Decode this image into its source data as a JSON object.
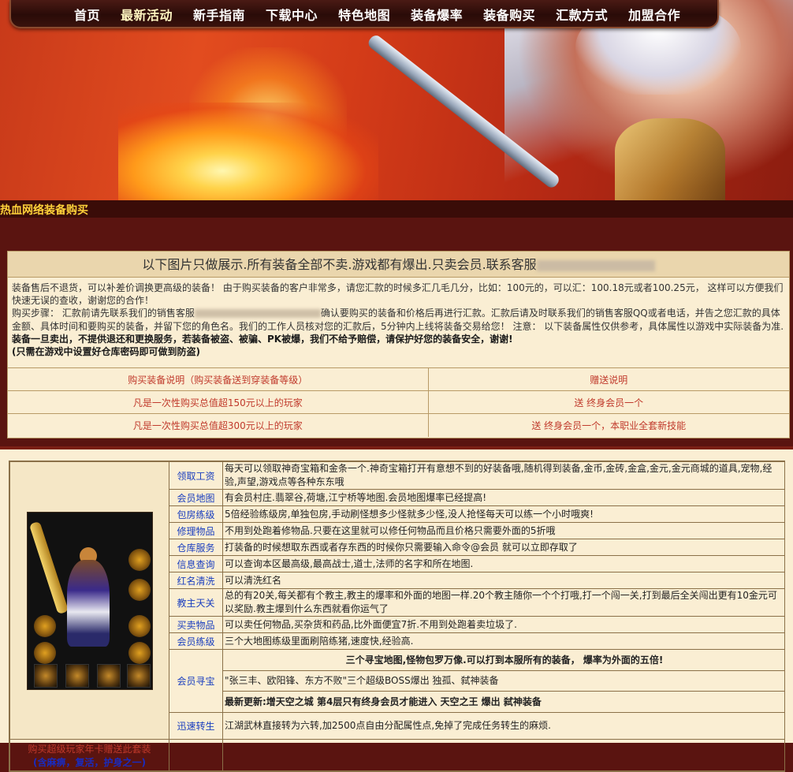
{
  "nav": {
    "items": [
      "首页",
      "最新活动",
      "新手指南",
      "下载中心",
      "特色地图",
      "装备爆率",
      "装备购买",
      "汇款方式",
      "加盟合作"
    ]
  },
  "strip": {
    "title": "热血网络装备购买"
  },
  "info": {
    "headline": "以下图片只做展示.所有装备全部不卖.游戏都有爆出.只卖会员.联系客服",
    "p1": "装备售后不退货，可以补差价调换更高级的装备！ 由于购买装备的客户非常多，请您汇款的时候多汇几毛几分，比如：100元的，可以汇：100.18元或者100.25元， 这样可以方便我们快速无误的查收，谢谢您的合作！",
    "p2a": "购买步骤： 汇款前请先联系我们的销售客服",
    "p2b": "确认要购买的装备和价格后再进行汇款。汇款后请及时联系我们的销售客服QQ或者电话，并告之您汇款的具体金额、具体时间和要购买的装备，并留下您的角色名。我们的工作人员核对您的汇款后，5分钟内上线将装备交易给您！ 注意： 以下装备属性仅供参考，具体属性以游戏中实际装备为准.",
    "p2c": "装备一旦卖出，不提供退还和更换服务，若装备被盗、被骗、PK被爆，我们不给予赔偿，请保护好您的装备安全，谢谢!",
    "p3": "(只需在游戏中设置好仓库密码即可做到防盗)",
    "table": [
      [
        "购买装备说明（购买装备送到穿装备等级）",
        "赠送说明"
      ],
      [
        "凡是一次性购买总值超150元以上的玩家",
        "送 终身会员一个"
      ],
      [
        "凡是一次性购买总值超300元以上的玩家",
        "送 终身会员一个，本职业全套新技能"
      ]
    ]
  },
  "features": [
    {
      "label": "领取工资",
      "desc": "每天可以领取神奇宝箱和金条一个.神奇宝箱打开有意想不到的好装备哦,随机得到装备,金币,金砖,金盒,金元,金元商城的道具,宠物,经验,声望,游戏点等各种东东哦"
    },
    {
      "label": "会员地图",
      "desc": "有会员村庄.翡翠谷,荷塘,江宁桥等地图.会员地图爆率已经提高!"
    },
    {
      "label": "包房练级",
      "desc": "5倍经验练级房,单独包房,手动刷怪想多少怪就多少怪,没人抢怪每天可以练一个小时哦爽!"
    },
    {
      "label": "修理物品",
      "desc": "不用到处跑着修物品.只要在这里就可以修任何物品而且价格只需要外面的5折哦"
    },
    {
      "label": "仓库服务",
      "desc": "打装备的时候想取东西或者存东西的时候你只需要输入命令@会员 就可以立即存取了"
    },
    {
      "label": "信息查询",
      "desc": "可以查询本区最高级,最高战士,道士,法师的名字和所在地图."
    },
    {
      "label": "红名清洗",
      "desc": "可以清洗红名"
    },
    {
      "label": "教主天关",
      "desc": "总的有20关,每关都有个教主,教主的爆率和外面的地图一样.20个教主随你一个个打哦,打一个闯一关,打到最后全关闯出更有10金元可以奖励.教主爆到什么东西就看你运气了"
    },
    {
      "label": "买卖物品",
      "desc": "可以卖任何物品,买杂货和药品,比外面便宜7折.不用到处跑着卖垃圾了."
    },
    {
      "label": "会员练级",
      "desc": "三个大地图练级里面刷陪练猪,速度快,经验高."
    }
  ],
  "treasure": {
    "label": "会员寻宝",
    "line1": "三个寻宝地图,怪物包罗万像.可以打到本服所有的装备， 爆率为外面的五倍!",
    "line2": "\"张三丰、欧阳锋、东方不败\"三个超级BOSS爆出 独孤、弑神装备",
    "line3": "最新更新:增天空之城 第4层只有终身会员才能进入 天空之王 爆出 弑神装备"
  },
  "rebirth": {
    "label": "迅速转生",
    "desc": "江湖武林直接转为六转,加2500点自由分配属性点,免掉了完成任务转生的麻烦."
  },
  "bottom_left": {
    "line1": "购买超级玩家年卡赠送此套装",
    "line2": "(含麻痹，复活，护身之一)"
  }
}
